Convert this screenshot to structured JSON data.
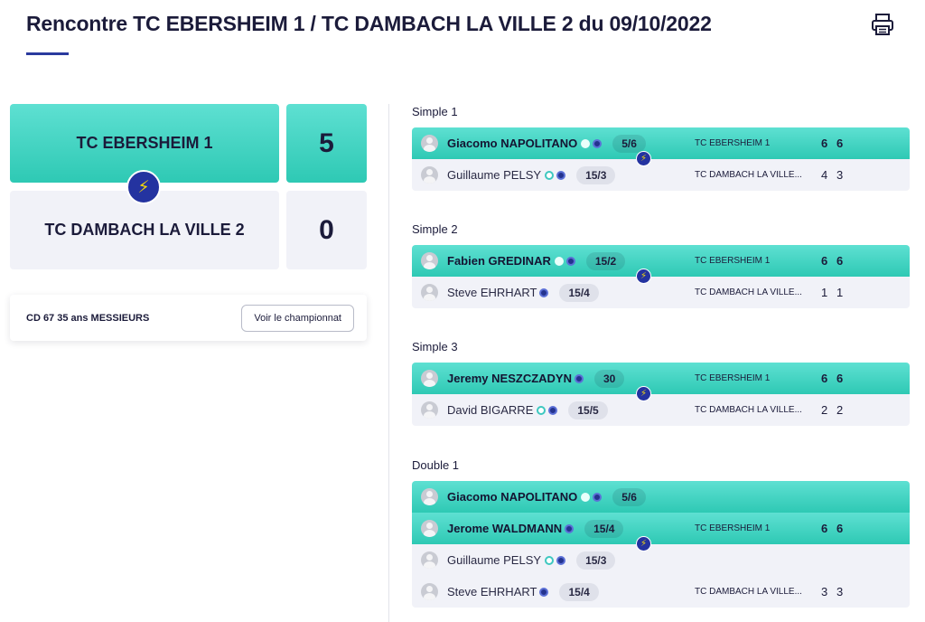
{
  "header": {
    "title": "Rencontre TC EBERSHEIM 1 / TC DAMBACH LA VILLE 2 du 09/10/2022",
    "print_icon": "printer-icon"
  },
  "scoreboard": {
    "team1": {
      "name": "TC EBERSHEIM 1",
      "score": "5"
    },
    "team2": {
      "name": "TC DAMBACH LA VILLE 2",
      "score": "0"
    },
    "winner_icon": "lightning-icon"
  },
  "championship": {
    "label": "CD 67 35 ans MESSIEURS",
    "button": "Voir le championnat"
  },
  "colors": {
    "accent": "#2ec9b4",
    "dark_blue": "#2433a0",
    "loser_bg": "#f1f2f8"
  },
  "matches": [
    {
      "title": "Simple 1",
      "winner": {
        "players": [
          {
            "name": "Giacomo NAPOLITANO",
            "rank": "5/6",
            "ring": true
          }
        ],
        "club": "TC EBERSHEIM 1",
        "sets": [
          "6",
          "6"
        ]
      },
      "loser": {
        "players": [
          {
            "name": "Guillaume PELSY",
            "rank": "15/3",
            "ring": true
          }
        ],
        "club": "TC DAMBACH LA VILLE...",
        "sets": [
          "4",
          "3"
        ]
      }
    },
    {
      "title": "Simple 2",
      "winner": {
        "players": [
          {
            "name": "Fabien GREDINAR",
            "rank": "15/2",
            "ring": true
          }
        ],
        "club": "TC EBERSHEIM 1",
        "sets": [
          "6",
          "6"
        ]
      },
      "loser": {
        "players": [
          {
            "name": "Steve EHRHART",
            "rank": "15/4",
            "ring": false
          }
        ],
        "club": "TC DAMBACH LA VILLE...",
        "sets": [
          "1",
          "1"
        ]
      }
    },
    {
      "title": "Simple 3",
      "winner": {
        "players": [
          {
            "name": "Jeremy NESZCZADYN",
            "rank": "30",
            "ring": false
          }
        ],
        "club": "TC EBERSHEIM 1",
        "sets": [
          "6",
          "6"
        ]
      },
      "loser": {
        "players": [
          {
            "name": "David BIGARRE",
            "rank": "15/5",
            "ring": true
          }
        ],
        "club": "TC DAMBACH LA VILLE...",
        "sets": [
          "2",
          "2"
        ]
      }
    },
    {
      "title": "Double 1",
      "winner": {
        "players": [
          {
            "name": "Giacomo NAPOLITANO",
            "rank": "5/6",
            "ring": true
          },
          {
            "name": "Jerome WALDMANN",
            "rank": "15/4",
            "ring": false
          }
        ],
        "club": "TC EBERSHEIM 1",
        "sets": [
          "6",
          "6"
        ]
      },
      "loser": {
        "players": [
          {
            "name": "Guillaume PELSY",
            "rank": "15/3",
            "ring": true
          },
          {
            "name": "Steve EHRHART",
            "rank": "15/4",
            "ring": false
          }
        ],
        "club": "TC DAMBACH LA VILLE...",
        "sets": [
          "3",
          "3"
        ]
      }
    }
  ]
}
